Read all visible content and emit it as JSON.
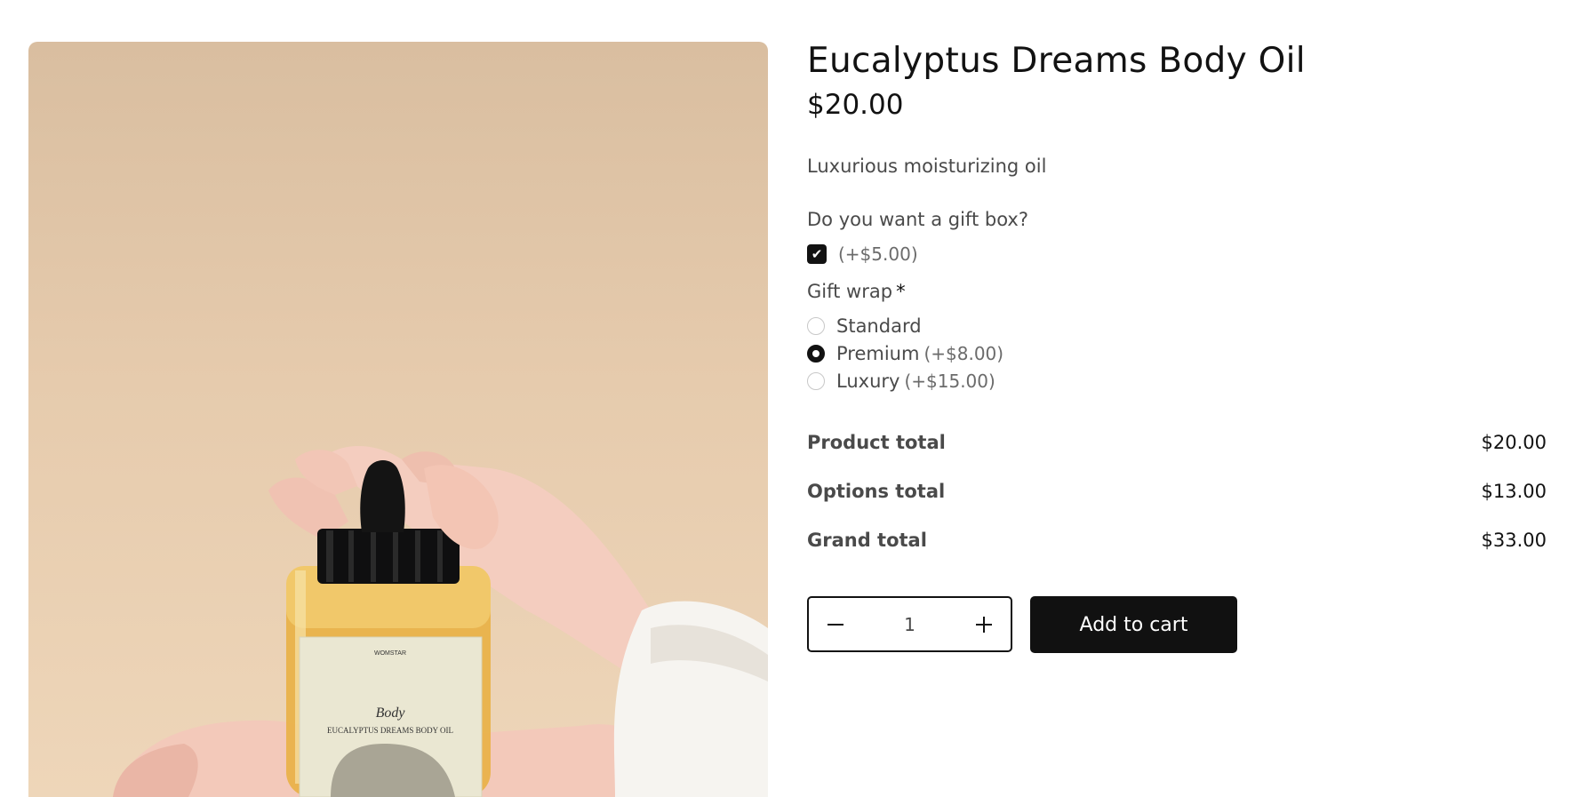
{
  "product": {
    "title": "Eucalyptus Dreams Body Oil",
    "price": "$20.00",
    "description": "Luxurious moisturizing oil",
    "image": {
      "brand_text": "WOMSTAR",
      "script_text": "Body",
      "label_text": "EUCALYPTUS DREAMS BODY OIL"
    }
  },
  "gift_box": {
    "question": "Do you want a gift box?",
    "price_label": "(+$5.00)",
    "checked": true
  },
  "gift_wrap": {
    "label": "Gift wrap",
    "required_mark": "*",
    "options": [
      {
        "name": "Standard",
        "extra": "",
        "selected": false
      },
      {
        "name": "Premium",
        "extra": "(+$8.00)",
        "selected": true
      },
      {
        "name": "Luxury",
        "extra": "(+$15.00)",
        "selected": false
      }
    ]
  },
  "totals": {
    "product_label": "Product total",
    "product_value": "$20.00",
    "options_label": "Options total",
    "options_value": "$13.00",
    "grand_label": "Grand total",
    "grand_value": "$33.00"
  },
  "quantity": {
    "value": "1",
    "minus_icon": "minus-icon",
    "plus_icon": "plus-icon"
  },
  "cart": {
    "button_label": "Add to cart"
  },
  "colors": {
    "primary": "#121212",
    "background_photo": "#e3c7a8"
  }
}
